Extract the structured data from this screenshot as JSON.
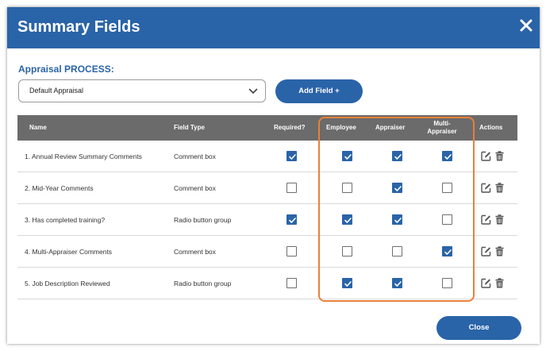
{
  "dialog": {
    "title": "Summary Fields",
    "close_icon": "close-icon"
  },
  "process": {
    "label": "Appraisal PROCESS:",
    "selected": "Default Appraisal",
    "dropdown_icon": "chevron-down-icon"
  },
  "add_field_label": "Add Field +",
  "table": {
    "headers": {
      "name": "Name",
      "field_type": "Field Type",
      "required": "Required?",
      "employee": "Employee",
      "appraiser": "Appraiser",
      "multi_line1": "Multi-",
      "multi_line2": "Appraiser",
      "actions": "Actions"
    },
    "rows": [
      {
        "name": "1. Annual Review Summary Comments",
        "type": "Comment box",
        "required": true,
        "employee": true,
        "appraiser": true,
        "multi": true
      },
      {
        "name": "2. Mid-Year Comments",
        "type": "Comment box",
        "required": false,
        "employee": false,
        "appraiser": true,
        "multi": false
      },
      {
        "name": "3. Has completed training?",
        "type": "Radio button group",
        "required": true,
        "employee": true,
        "appraiser": true,
        "multi": false
      },
      {
        "name": "4. Multi-Appraiser Comments",
        "type": "Comment box",
        "required": false,
        "employee": false,
        "appraiser": false,
        "multi": true
      },
      {
        "name": "5. Job Description Reviewed",
        "type": "Radio button group",
        "required": false,
        "employee": true,
        "appraiser": true,
        "multi": false
      }
    ],
    "action_icons": [
      "edit-icon",
      "trash-icon"
    ]
  },
  "close_button_label": "Close",
  "colors": {
    "header_blue": "#2a64a8",
    "table_header_gray": "#6b6b6b",
    "highlight_orange": "#e8813a"
  }
}
